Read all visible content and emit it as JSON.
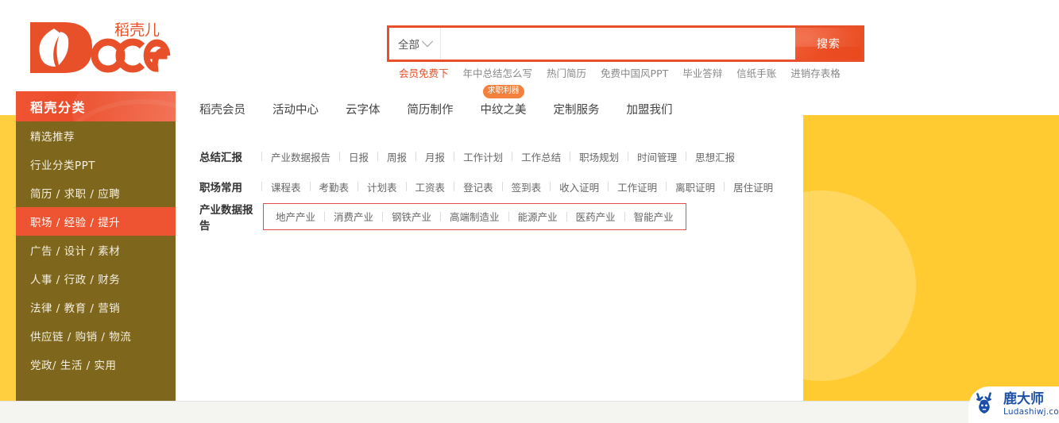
{
  "brand": {
    "logo_cn": "稻壳儿",
    "logo_en": "Docer"
  },
  "search": {
    "category_label": "全部",
    "category_icon": "chevron-down-icon",
    "input_value": "",
    "placeholder": "",
    "button_label": "搜索",
    "hotwords": [
      {
        "label": "会员免费下",
        "highlight": true
      },
      {
        "label": "年中总结怎么写",
        "highlight": false
      },
      {
        "label": "热门简历",
        "highlight": false
      },
      {
        "label": "免费中国风PPT",
        "highlight": false
      },
      {
        "label": "毕业答辩",
        "highlight": false
      },
      {
        "label": "信纸手账",
        "highlight": false
      },
      {
        "label": "进销存表格",
        "highlight": false
      }
    ]
  },
  "sidebar": {
    "title": "稻壳分类",
    "items": [
      {
        "label": "精选推荐",
        "active": false
      },
      {
        "label": "行业分类PPT",
        "active": false
      },
      {
        "label": "简历 / 求职 / 应聘",
        "active": false
      },
      {
        "label": "职场 / 经验 / 提升",
        "active": true
      },
      {
        "label": "广告 / 设计 / 素材",
        "active": false
      },
      {
        "label": "人事 / 行政 / 财务",
        "active": false
      },
      {
        "label": "法律 / 教育 / 营销",
        "active": false
      },
      {
        "label": "供应链 / 购销 / 物流",
        "active": false
      },
      {
        "label": "党政/ 生活 / 实用",
        "active": false
      }
    ]
  },
  "topnav": {
    "items": [
      {
        "label": "稻壳会员",
        "badge": ""
      },
      {
        "label": "活动中心",
        "badge": ""
      },
      {
        "label": "云字体",
        "badge": ""
      },
      {
        "label": "简历制作",
        "badge": ""
      },
      {
        "label": "中纹之美",
        "badge": "求职利器"
      },
      {
        "label": "定制服务",
        "badge": ""
      },
      {
        "label": "加盟我们",
        "badge": ""
      }
    ]
  },
  "categories": [
    {
      "label": "总结汇报",
      "boxed": false,
      "links": [
        "产业数据报告",
        "日报",
        "周报",
        "月报",
        "工作计划",
        "工作总结",
        "职场规划",
        "时间管理",
        "思想汇报"
      ]
    },
    {
      "label": "职场常用",
      "boxed": false,
      "links": [
        "课程表",
        "考勤表",
        "计划表",
        "工资表",
        "登记表",
        "签到表",
        "收入证明",
        "工作证明",
        "离职证明",
        "居住证明"
      ]
    },
    {
      "label": "产业数据报告",
      "boxed": true,
      "links": [
        "地产产业",
        "消费产业",
        "钢铁产业",
        "高端制造业",
        "能源产业",
        "医药产业",
        "智能产业"
      ]
    }
  ],
  "watermark": {
    "name_cn": "鹿大师",
    "name_en": "Ludashiwj.com",
    "icon": "deer-head-icon"
  },
  "colors": {
    "brand_orange": "#e8502a",
    "sidebar_olive": "#7e671c",
    "sidebar_active": "#ee5431",
    "panel_yellow": "#ffcb31",
    "badge_orange": "#f4813b",
    "highlight_box": "#e04c50",
    "watermark_blue": "#1c4fa8"
  }
}
